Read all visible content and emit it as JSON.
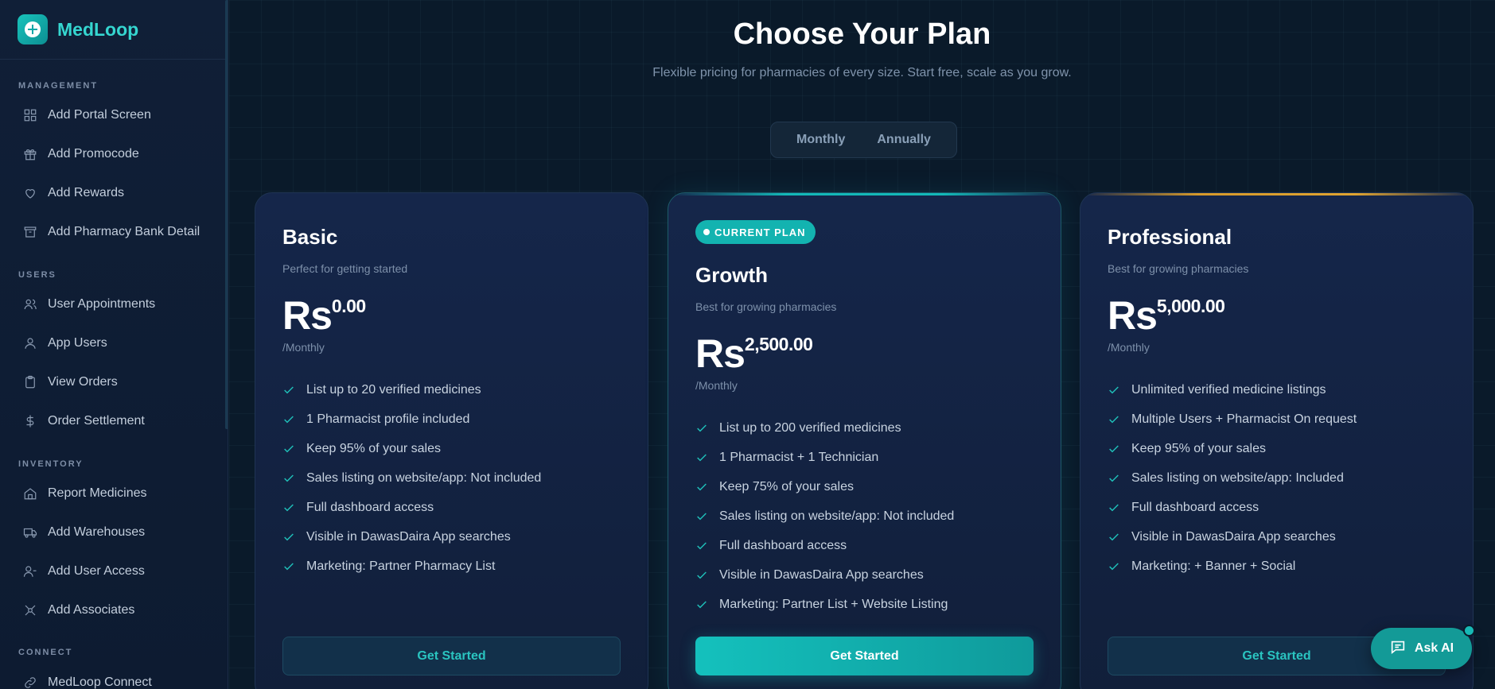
{
  "brand": {
    "name": "MedLoop"
  },
  "sidebar": {
    "sections": [
      {
        "label": "MANAGEMENT",
        "items": [
          {
            "label": "Add Portal Screen",
            "icon": "grid-icon"
          },
          {
            "label": "Add Promocode",
            "icon": "gift-icon"
          },
          {
            "label": "Add Rewards",
            "icon": "heart-icon"
          },
          {
            "label": "Add Pharmacy Bank Detail",
            "icon": "archive-icon"
          }
        ]
      },
      {
        "label": "USERS",
        "items": [
          {
            "label": "User Appointments",
            "icon": "users-icon"
          },
          {
            "label": "App Users",
            "icon": "user-icon"
          },
          {
            "label": "View Orders",
            "icon": "clipboard-icon"
          },
          {
            "label": "Order Settlement",
            "icon": "dollar-icon"
          }
        ]
      },
      {
        "label": "INVENTORY",
        "items": [
          {
            "label": "Report Medicines",
            "icon": "home-icon"
          },
          {
            "label": "Add Warehouses",
            "icon": "truck-icon"
          },
          {
            "label": "Add User Access",
            "icon": "user-minus-icon"
          },
          {
            "label": "Add Associates",
            "icon": "network-icon"
          }
        ]
      },
      {
        "label": "CONNECT",
        "items": [
          {
            "label": "MedLoop Connect",
            "icon": "link-icon"
          }
        ]
      }
    ]
  },
  "header": {
    "title": "Choose Your Plan",
    "subtitle": "Flexible pricing for pharmacies of every size. Start free, scale as you grow."
  },
  "billing_toggle": {
    "monthly": "Monthly",
    "annually": "Annually"
  },
  "plans": [
    {
      "name": "Basic",
      "tagline": "Perfect for getting started",
      "currency": "Rs",
      "amount": "0.00",
      "period": "/Monthly",
      "features": [
        "List up to 20 verified medicines",
        "1 Pharmacist profile included",
        "Keep 95% of your sales",
        "Sales listing on website/app: Not included",
        "Full dashboard access",
        "Visible in DawasDaira App searches",
        "Marketing: Partner Pharmacy List"
      ],
      "cta": "Get Started"
    },
    {
      "badge": "CURRENT PLAN",
      "name": "Growth",
      "tagline": "Best for growing pharmacies",
      "currency": "Rs",
      "amount": "2,500.00",
      "period": "/Monthly",
      "features": [
        "List up to 200 verified medicines",
        "1 Pharmacist + 1 Technician",
        "Keep 75% of your sales",
        "Sales listing on website/app: Not included",
        "Full dashboard access",
        "Visible in DawasDaira App searches",
        "Marketing: Partner List + Website Listing"
      ],
      "cta": "Get Started"
    },
    {
      "name": "Professional",
      "tagline": "Best for growing pharmacies",
      "currency": "Rs",
      "amount": "5,000.00",
      "period": "/Monthly",
      "features": [
        "Unlimited verified medicine listings",
        "Multiple Users + Pharmacist On request",
        "Keep 95% of your sales",
        "Sales listing on website/app: Included",
        "Full dashboard access",
        "Visible in DawasDaira App searches",
        "Marketing: + Banner + Social"
      ],
      "cta": "Get Started"
    }
  ],
  "ask_ai": {
    "label": "Ask AI"
  },
  "colors": {
    "accent": "#13b3b0",
    "pro_accent": "#d79a2a",
    "background": "#0a1a2a"
  }
}
